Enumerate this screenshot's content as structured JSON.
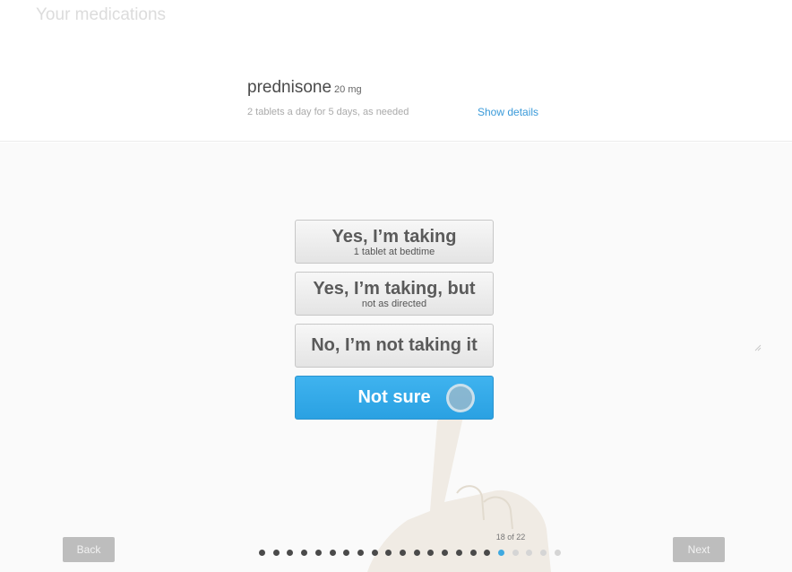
{
  "header": {
    "title": "Your medications"
  },
  "medication": {
    "name": "prednisone",
    "dose": "20 mg",
    "instructions": "2 tablets a day for 5 days, as needed",
    "details_link": "Show details"
  },
  "choices": [
    {
      "main": "Yes, I’m taking",
      "sub": "1 tablet at bedtime"
    },
    {
      "main": "Yes, I’m taking, but",
      "sub": "not as directed"
    },
    {
      "main": "No, I’m not taking it",
      "sub": ""
    },
    {
      "main": "Not sure",
      "sub": ""
    }
  ],
  "navigation": {
    "back_label": "Back",
    "next_label": "Next"
  },
  "progress": {
    "label": "18 of 22",
    "current": 18,
    "total": 22
  },
  "colors": {
    "accent": "#2aa1e2",
    "link": "#3a9ad9",
    "dot_done": "#4a4a4a",
    "dot_current": "#3fa9e0",
    "dot_remaining": "#d5d5d5"
  },
  "icons": {
    "tap_indicator": "tap-circle-icon",
    "hand": "pointing-hand-icon"
  }
}
